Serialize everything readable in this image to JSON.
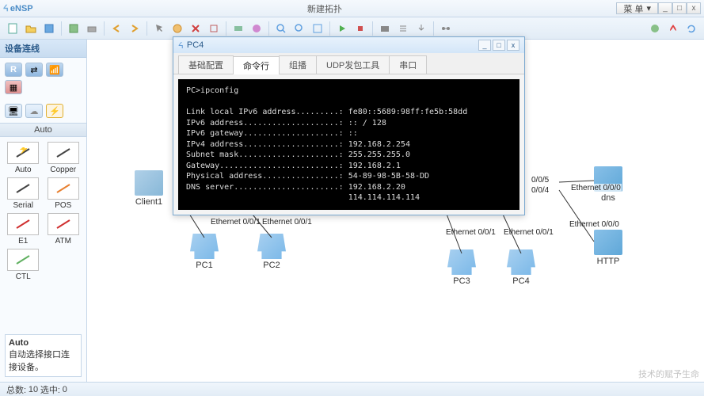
{
  "app": {
    "name": "eNSP",
    "title": "新建拓扑",
    "menu": "菜 单"
  },
  "winbtns": {
    "min": "_",
    "max": "□",
    "close": "x"
  },
  "status": {
    "total_label": "总数:",
    "total": "10",
    "sel_label": "选中:",
    "sel": "0"
  },
  "watermark": "技术的赋予生命",
  "sidebar": {
    "panel_title": "设备连线",
    "auto_label": "Auto",
    "cables": [
      {
        "name": "Auto",
        "color": "#444"
      },
      {
        "name": "Copper",
        "color": "#444"
      },
      {
        "name": "Serial",
        "color": "#444"
      },
      {
        "name": "POS",
        "color": "#e88030"
      },
      {
        "name": "E1",
        "color": "#d03030"
      },
      {
        "name": "ATM",
        "color": "#d03030"
      },
      {
        "name": "CTL",
        "color": "#60b060"
      }
    ],
    "desc_title": "Auto",
    "desc_text": "自动选择接口连接设备。"
  },
  "nodes": {
    "client1": "Client1",
    "pc1": "PC1",
    "pc2": "PC2",
    "pc3": "PC3",
    "pc4": "PC4",
    "dns": "dns",
    "http": "HTTP"
  },
  "ports": {
    "p001a": "Ethernet 0/0/1",
    "p001b": "Ethernet 0/0/1",
    "p001c": "Ethernet 0/0/1",
    "p001d": "Ethernet 0/0/1",
    "p004": "0/0/4",
    "p005": "0/0/5",
    "pdns": "Ethernet 0/0/0",
    "phttp": "Ethernet 0/0/0"
  },
  "pc4win": {
    "title": "PC4",
    "tabs": [
      "基础配置",
      "命令行",
      "组播",
      "UDP发包工具",
      "串口"
    ],
    "active_tab": 1,
    "term": "PC>ipconfig\n\nLink local IPv6 address.........: fe80::5689:98ff:fe5b:58dd\nIPv6 address....................: :: / 128\nIPv6 gateway....................: ::\nIPv4 address....................: 192.168.2.254\nSubnet mask.....................: 255.255.255.0\nGateway.........................: 192.168.2.1\nPhysical address................: 54-89-98-5B-58-DD\nDNS server......................: 192.168.2.20\n                                  114.114.114.114\n"
  }
}
